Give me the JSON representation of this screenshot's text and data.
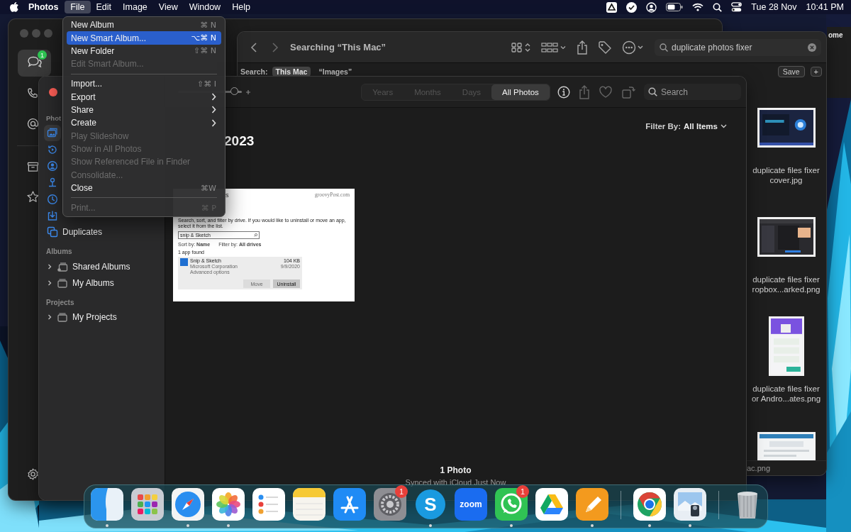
{
  "menu_bar": {
    "app_name": "Photos",
    "menus": [
      {
        "label": "File",
        "selected": true
      },
      {
        "label": "Edit",
        "selected": false
      },
      {
        "label": "Image",
        "selected": false
      },
      {
        "label": "View",
        "selected": false
      },
      {
        "label": "Window",
        "selected": false
      },
      {
        "label": "Help",
        "selected": false
      }
    ],
    "date": "Tue 28 Nov",
    "time": "10:41 PM"
  },
  "messages_window": {
    "rail": [
      {
        "kind": "chat",
        "selected": true,
        "badge": "1"
      },
      {
        "kind": "phone",
        "selected": false
      },
      {
        "kind": "at",
        "selected": false
      },
      {
        "kind": "archive",
        "selected": false
      },
      {
        "kind": "star",
        "selected": false
      },
      {
        "kind": "settings",
        "selected": false
      }
    ]
  },
  "back_window": {
    "title": "ome"
  },
  "finder_window": {
    "title": "Searching “This Mac”",
    "search_query": "duplicate photos fixer",
    "search_label": "Search:",
    "scopes": [
      {
        "label": "This Mac",
        "selected": true
      },
      {
        "label": "“Images”",
        "selected": false
      }
    ],
    "save_button": "Save",
    "add_button": "+",
    "files": [
      {
        "kind": "picture",
        "caption": [
          "duplicate files fixer",
          "cover.jpg"
        ]
      },
      {
        "kind": "picture",
        "caption": [
          "duplicate files fixer",
          "ropbox...arked.png"
        ]
      },
      {
        "kind": "picture",
        "caption": [
          "duplicate files fixer",
          "or Andro...ates.png"
        ]
      },
      {
        "kind": "picture"
      }
    ],
    "path_bar": "ac.png"
  },
  "photos_window": {
    "zoom_slider": {
      "level": 0.9
    },
    "view_tabs": [
      {
        "label": "Years",
        "selected": false
      },
      {
        "label": "Months",
        "selected": false
      },
      {
        "label": "Days",
        "selected": false
      },
      {
        "label": "All Photos",
        "selected": true
      }
    ],
    "search_placeholder": "Search",
    "sidebar": [
      {
        "header": "Phot",
        "items": [
          {
            "kind": "library",
            "selected": true
          },
          {
            "kind": "memories",
            "selected": false
          },
          {
            "kind": "people",
            "selected": false
          },
          {
            "kind": "places",
            "selected": false
          },
          {
            "kind": "recents",
            "selected": false
          },
          {
            "kind": "imports",
            "selected": false
          },
          {
            "kind": "duplicates",
            "label": "Duplicates",
            "selected": false
          }
        ]
      },
      {
        "header": "Albums",
        "items": [
          {
            "kind": "shared",
            "label": "Shared Albums",
            "selected": false,
            "expanded": false
          },
          {
            "kind": "folder",
            "label": "My Albums",
            "selected": false,
            "expanded": false
          }
        ]
      },
      {
        "header": "Projects",
        "items": [
          {
            "kind": "folder",
            "label": "My Projects",
            "selected": false,
            "expanded": false
          }
        ]
      }
    ],
    "filter_label": "Filter By:",
    "filter_value": "All Items",
    "heading": "2023",
    "photo": {
      "title": "s",
      "watermark": "groovyPost.com",
      "description": "Search, sort, and filter by drive. If you would like to uninstall or move an app, select it from the list.",
      "search_value": "snip & Sketch",
      "sort_label": "Sort by:",
      "sort_value": "Name",
      "filter_label": "Filter by:",
      "filter_value": "All drives",
      "result_count": "1 app found",
      "app": {
        "name": "Snip & Sketch",
        "publisher": "Microsoft Corporation",
        "link": "Advanced options",
        "size": "104 KB",
        "date": "9/9/2020"
      },
      "buttons": [
        {
          "label": "Move",
          "disabled": true
        },
        {
          "label": "Uninstall",
          "disabled": false
        }
      ]
    },
    "footer_count": "1 Photo",
    "footer_status": "Synced with iCloud Just Now"
  },
  "file_menu": {
    "items": [
      {
        "kind": "item",
        "label": "New Album",
        "shortcut": "⌘ N",
        "disabled": false,
        "selected": false
      },
      {
        "kind": "item",
        "label": "New Smart Album...",
        "shortcut": "⌥⌘ N",
        "disabled": false,
        "selected": true
      },
      {
        "kind": "item",
        "label": "New Folder",
        "shortcut": "⇧⌘ N",
        "disabled": false,
        "selected": false
      },
      {
        "kind": "item",
        "label": "Edit Smart Album...",
        "disabled": true,
        "selected": false
      },
      {
        "kind": "separator"
      },
      {
        "kind": "item",
        "label": "Import...",
        "shortcut": "⇧⌘ I",
        "disabled": false,
        "selected": false
      },
      {
        "kind": "submenu",
        "label": "Export",
        "disabled": false,
        "selected": false
      },
      {
        "kind": "submenu",
        "label": "Share",
        "disabled": false,
        "selected": false
      },
      {
        "kind": "submenu",
        "label": "Create",
        "disabled": false,
        "selected": false
      },
      {
        "kind": "item",
        "label": "Play Slideshow",
        "disabled": true,
        "selected": false
      },
      {
        "kind": "item",
        "label": "Show in All Photos",
        "disabled": true,
        "selected": false
      },
      {
        "kind": "item",
        "label": "Show Referenced File in Finder",
        "disabled": true,
        "selected": false
      },
      {
        "kind": "item",
        "label": "Consolidate...",
        "disabled": true,
        "selected": false
      },
      {
        "kind": "item",
        "label": "Close",
        "shortcut": "⌘W",
        "disabled": false,
        "selected": false
      },
      {
        "kind": "separator"
      },
      {
        "kind": "item",
        "label": "Print...",
        "shortcut": "⌘ P",
        "disabled": true,
        "selected": false
      }
    ]
  },
  "dock": {
    "items": [
      {
        "kind": "finder",
        "running": true
      },
      {
        "kind": "launchpad",
        "running": false
      },
      {
        "kind": "safari",
        "running": true
      },
      {
        "kind": "photos",
        "running": true
      },
      {
        "kind": "reminders",
        "running": false
      },
      {
        "kind": "notes",
        "running": false
      },
      {
        "kind": "appstore",
        "running": false
      },
      {
        "kind": "settings",
        "running": false,
        "badge": "1"
      },
      {
        "kind": "skype",
        "glyph": "S",
        "running": true
      },
      {
        "kind": "zoom",
        "glyph": "zoom",
        "running": false
      },
      {
        "kind": "whatsapp",
        "running": true,
        "badge": "1"
      },
      {
        "kind": "drive",
        "running": false
      },
      {
        "kind": "pages",
        "running": true
      },
      {
        "kind": "separator"
      },
      {
        "kind": "chrome",
        "running": true
      },
      {
        "kind": "preview",
        "running": true
      },
      {
        "kind": "separator"
      },
      {
        "kind": "trash",
        "running": false
      }
    ]
  }
}
